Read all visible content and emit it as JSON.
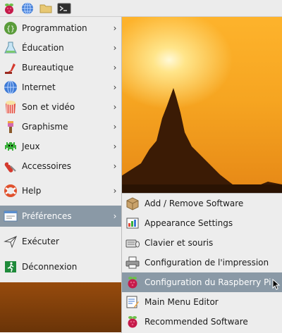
{
  "main_menu": {
    "items": [
      {
        "label": "Programmation",
        "icon": "programming-icon",
        "has_submenu": true
      },
      {
        "label": "Éducation",
        "icon": "education-icon",
        "has_submenu": true
      },
      {
        "label": "Bureautique",
        "icon": "office-icon",
        "has_submenu": true
      },
      {
        "label": "Internet",
        "icon": "internet-icon",
        "has_submenu": true
      },
      {
        "label": "Son et vidéo",
        "icon": "sound-video-icon",
        "has_submenu": true
      },
      {
        "label": "Graphisme",
        "icon": "graphics-icon",
        "has_submenu": true
      },
      {
        "label": "Jeux",
        "icon": "games-icon",
        "has_submenu": true
      },
      {
        "label": "Accessoires",
        "icon": "accessories-icon",
        "has_submenu": true
      },
      {
        "label": "Help",
        "icon": "help-icon",
        "has_submenu": true
      },
      {
        "label": "Préférences",
        "icon": "preferences-icon",
        "has_submenu": true,
        "active": true
      },
      {
        "label": "Exécuter",
        "icon": "run-icon",
        "has_submenu": false
      },
      {
        "label": "Déconnexion",
        "icon": "logout-icon",
        "has_submenu": false
      }
    ],
    "arrow": "›"
  },
  "sub_menu": {
    "items": [
      {
        "label": "Add / Remove Software",
        "icon": "package-icon"
      },
      {
        "label": "Appearance Settings",
        "icon": "appearance-icon"
      },
      {
        "label": "Clavier et souris",
        "icon": "keyboard-mouse-icon"
      },
      {
        "label": "Configuration de l'impression",
        "icon": "printer-icon"
      },
      {
        "label": "Configuration du Raspberry Pi",
        "icon": "raspberry-icon",
        "active": true
      },
      {
        "label": "Main Menu Editor",
        "icon": "menu-editor-icon"
      },
      {
        "label": "Recommended Software",
        "icon": "raspberry-icon"
      }
    ]
  },
  "colors": {
    "highlight": "#8a99a6",
    "menu_bg": "#ededed",
    "accent_raspberry": "#c51a4a"
  }
}
